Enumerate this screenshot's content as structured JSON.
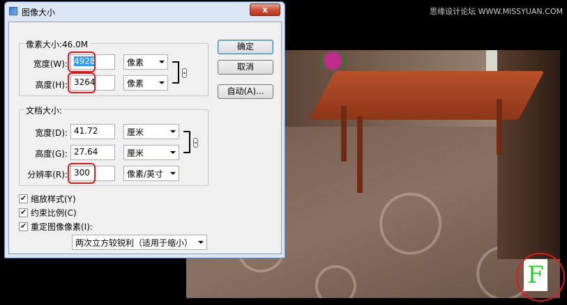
{
  "watermark": "思缘设计论坛 WWW.MISSYUAN.COM",
  "dialog": {
    "title": "图像大小",
    "close_label": "x",
    "pixel_dims": {
      "legend": "像素大小:46.0M",
      "width_label": "宽度(W):",
      "width_value": "4928",
      "width_unit": "像素",
      "height_label": "高度(H):",
      "height_value": "3264",
      "height_unit": "像素"
    },
    "doc_size": {
      "legend": "文档大小:",
      "width_label": "宽度(D):",
      "width_value": "41.72",
      "width_unit": "厘米",
      "height_label": "高度(G):",
      "height_value": "27.64",
      "height_unit": "厘米",
      "resolution_label": "分辨率(R):",
      "resolution_value": "300",
      "resolution_unit": "像素/英寸"
    },
    "checkboxes": {
      "scale_styles": "缩放样式(Y)",
      "constrain": "约束比例(C)",
      "resample": "重定图像像素(I):"
    },
    "resample_method": "两次立方较锐利（适用于缩小）",
    "buttons": {
      "ok": "确定",
      "cancel": "取消",
      "auto": "自动(A)..."
    }
  },
  "photo": {
    "badge_letter": "F"
  },
  "colors": {
    "highlight": "#e01818",
    "selection": "#3399ff",
    "badge_green": "#2ad02a"
  }
}
